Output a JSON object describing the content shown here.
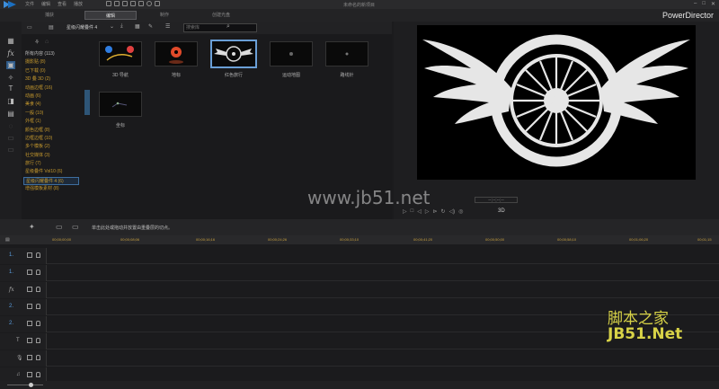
{
  "menu": [
    "文件",
    "编辑",
    "查看",
    "播放"
  ],
  "project_title": "未命名的新项目",
  "modes": [
    "捕获",
    "编辑",
    "制作",
    "创建光盘"
  ],
  "brand": "PowerDirector",
  "library": {
    "category_select": "星级闪耀叠件 4",
    "search_placeholder": "搜索库",
    "categories": [
      "所有内容 (113)",
      "摄影贴 (8)",
      "已下载 (0)",
      "3D 叠 3D (2)",
      "动画边框 (16)",
      "动画 (6)",
      "美食 (4)",
      "一般 (10)",
      "外框 (1)",
      "颜色边框 (8)",
      "边框边框 (10)",
      "多个模板 (2)",
      "社交媒体 (3)",
      "旅行 (7)",
      "星级叠件 Vol10 (6)",
      "星级闪耀叠件 4 (6)",
      "增强模板素材 (8)"
    ],
    "thumbnails": [
      "3D 导航",
      "地标",
      "红色旅行",
      "运动地图",
      "路线针",
      "坐标"
    ]
  },
  "preview": {
    "timecode": "--;--;--;--",
    "three_d": "3D"
  },
  "timeline": {
    "hint": "单击此处或拖动并放置由重叠层的切点。",
    "ruler": [
      "00;00;00;00",
      "00;00;08;06",
      "00;00;16;16",
      "00;00;24;26",
      "00;00;33;10",
      "00;00;41;20",
      "00;00;50;00",
      "00;00;58;10",
      "00;01;06;20",
      "00;01;15"
    ],
    "tracks": [
      "1.",
      "1.",
      "fx",
      "2.",
      "2.",
      "T",
      "🎙",
      "♫"
    ]
  },
  "watermarks": {
    "main": "www.jb51.net",
    "corner_top": "脚本之家",
    "corner_bottom": "JB51.Net"
  },
  "colors": {
    "accent_blue": "#5a9ee0",
    "category_text": "#c79a2e",
    "watermark_yellow": "#d7d247"
  }
}
